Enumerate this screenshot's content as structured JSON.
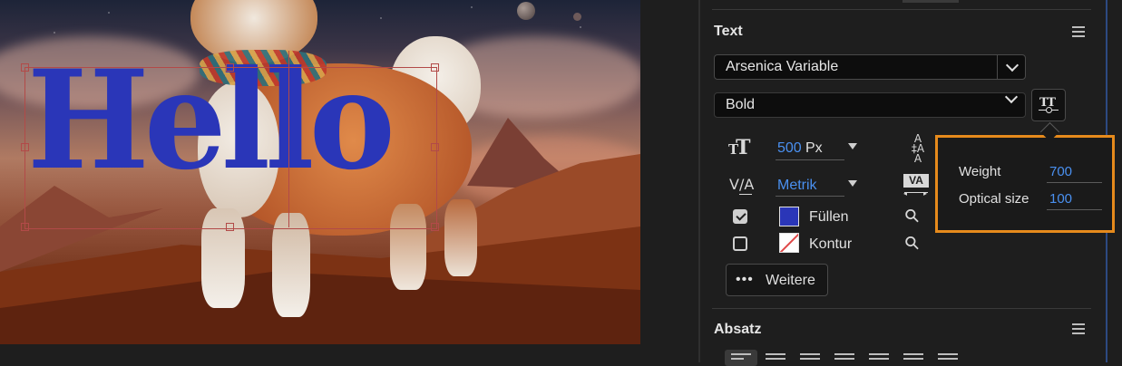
{
  "canvas": {
    "headline": "Hello"
  },
  "panel": {
    "text_section": {
      "title": "Text",
      "font_family": "Arsenica Variable",
      "font_style": "Bold",
      "size": {
        "value": "500",
        "unit": "Px"
      },
      "kerning": {
        "value": "Metrik"
      },
      "fill": {
        "label": "Füllen",
        "checked": true,
        "color": "#2a36b8"
      },
      "stroke": {
        "label": "Kontur",
        "checked": false
      },
      "more_button": "Weitere"
    },
    "variable_axes": {
      "weight": {
        "label": "Weight",
        "value": "700"
      },
      "optical_size": {
        "label": "Optical size",
        "value": "100"
      }
    },
    "paragraph_section": {
      "title": "Absatz"
    }
  },
  "colors": {
    "accent_blue": "#4a90f0",
    "highlight_orange": "#e68a1c",
    "text_fill": "#2a36b8"
  }
}
